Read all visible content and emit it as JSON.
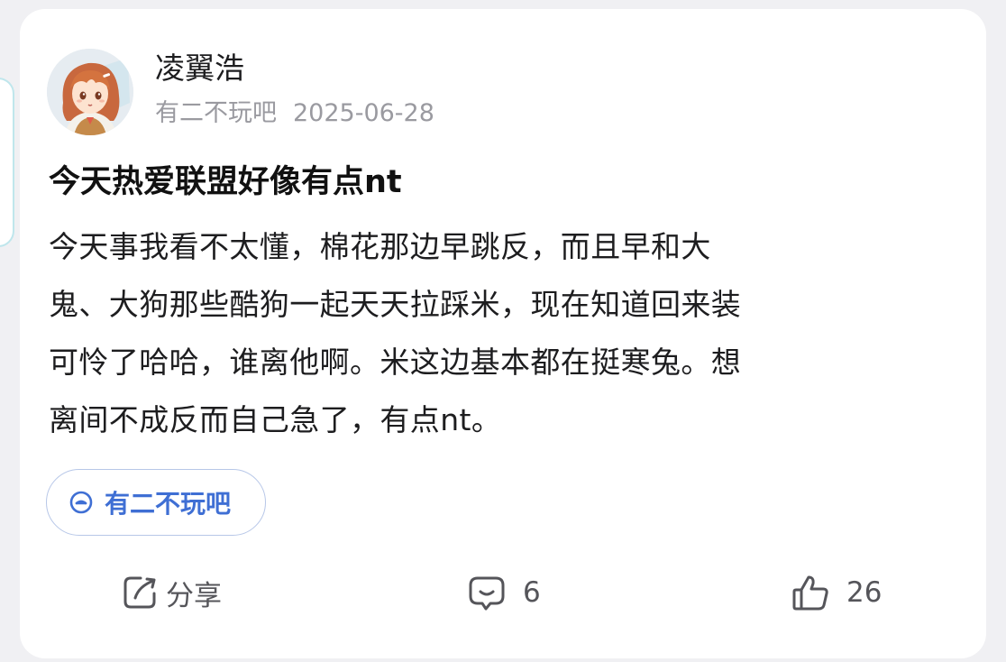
{
  "post": {
    "author": "凌翼浩",
    "forum": "有二不玩吧",
    "date": "2025-06-28",
    "title": "今天热爱联盟好像有点nt",
    "body_lines": [
      "今天事我看不太懂，棉花那边早跳反，而且早和大",
      "鬼、大狗那些酷狗一起天天拉踩米，现在知道回来装",
      "可怜了哈哈，谁离他啊。米这边基本都在挺寒兔。想",
      "离间不成反而自己急了，有点nt。"
    ],
    "tag": "有二不玩吧"
  },
  "actions": {
    "share_label": "分享",
    "comment_count": "6",
    "like_count": "26"
  },
  "icons": {
    "avatar": "anime-girl-avatar",
    "tag": "forum-icon",
    "share": "share-icon",
    "comment": "comment-icon",
    "like": "thumbs-up-icon"
  },
  "colors": {
    "tag_text": "#3f6fd4",
    "tag_border": "#b7c7e8",
    "meta_text": "#9a9aa0",
    "card_bg": "#ffffff",
    "page_bg": "#f0f0f3"
  }
}
